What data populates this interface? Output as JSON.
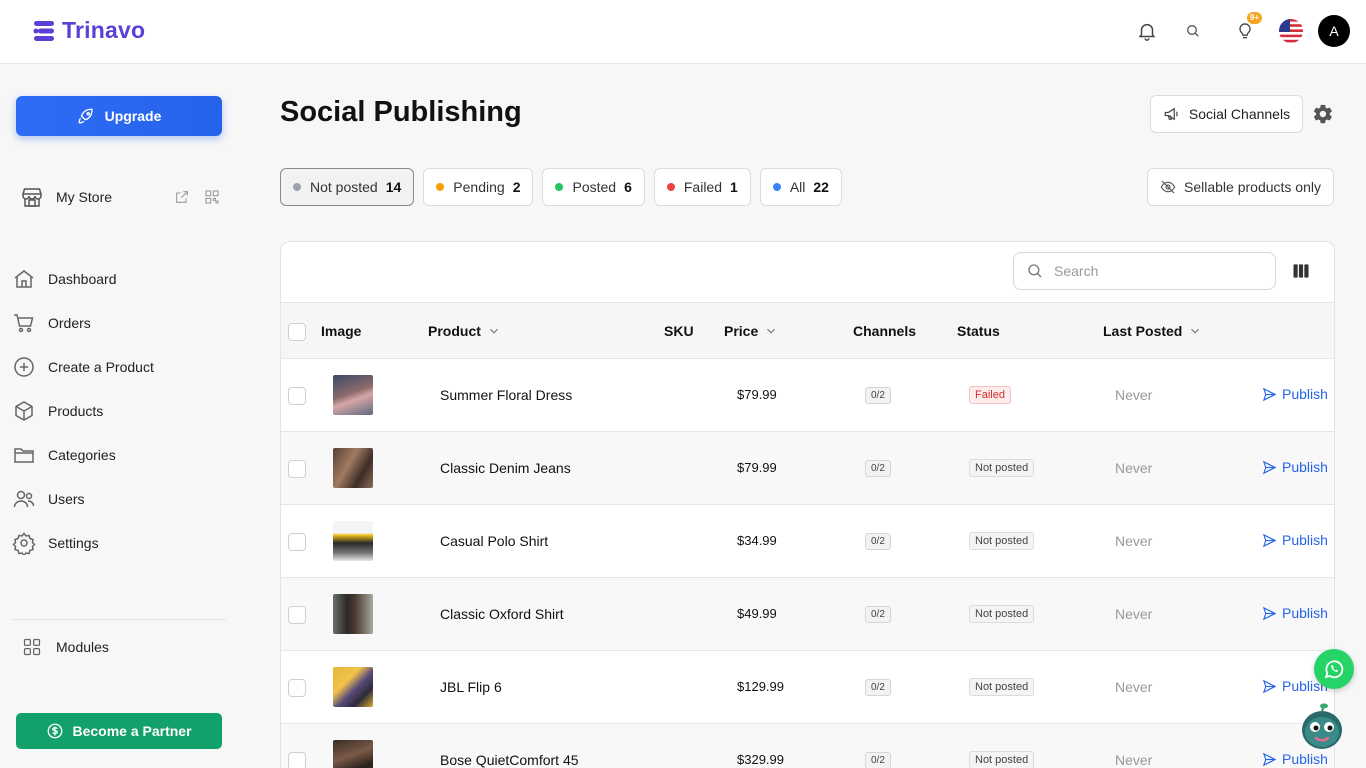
{
  "app": {
    "name": "Trinavo"
  },
  "topbar": {
    "notification_badge": "9+",
    "avatar_initial": "A",
    "icons": [
      "bell-icon",
      "search-icon",
      "lightbulb-icon",
      "us-flag-icon"
    ]
  },
  "sidebar": {
    "upgrade_label": "Upgrade",
    "store_label": "My Store",
    "nav": [
      {
        "label": "Dashboard",
        "icon": "home-icon"
      },
      {
        "label": "Orders",
        "icon": "cart-icon"
      },
      {
        "label": "Create a Product",
        "icon": "plus-circle-icon"
      },
      {
        "label": "Products",
        "icon": "box-icon"
      },
      {
        "label": "Categories",
        "icon": "folder-icon"
      },
      {
        "label": "Users",
        "icon": "users-icon"
      },
      {
        "label": "Settings",
        "icon": "gear-icon"
      }
    ],
    "modules_label": "Modules",
    "partner_label": "Become a Partner"
  },
  "page": {
    "title": "Social Publishing",
    "social_channels_label": "Social Channels",
    "sellable_label": "Sellable products only",
    "filters": [
      {
        "label": "Not posted",
        "count": "14",
        "color": "#9ca3af"
      },
      {
        "label": "Pending",
        "count": "2",
        "color": "#f59e0b"
      },
      {
        "label": "Posted",
        "count": "6",
        "color": "#22c55e"
      },
      {
        "label": "Failed",
        "count": "1",
        "color": "#ef4444"
      },
      {
        "label": "All",
        "count": "22",
        "color": "#3b82f6"
      }
    ],
    "search_placeholder": "Search"
  },
  "table": {
    "columns": [
      "Image",
      "Product",
      "SKU",
      "Price",
      "Channels",
      "Status",
      "Last Posted"
    ],
    "rows": [
      {
        "product": "Summer Floral Dress",
        "sku": "",
        "price": "$79.99",
        "channels": "0/2",
        "status": "Failed",
        "last_posted": "Never",
        "action": "Publish"
      },
      {
        "product": "Classic Denim Jeans",
        "sku": "",
        "price": "$79.99",
        "channels": "0/2",
        "status": "Not posted",
        "last_posted": "Never",
        "action": "Publish"
      },
      {
        "product": "Casual Polo Shirt",
        "sku": "",
        "price": "$34.99",
        "channels": "0/2",
        "status": "Not posted",
        "last_posted": "Never",
        "action": "Publish"
      },
      {
        "product": "Classic Oxford Shirt",
        "sku": "",
        "price": "$49.99",
        "channels": "0/2",
        "status": "Not posted",
        "last_posted": "Never",
        "action": "Publish"
      },
      {
        "product": "JBL Flip 6",
        "sku": "",
        "price": "$129.99",
        "channels": "0/2",
        "status": "Not posted",
        "last_posted": "Never",
        "action": "Publish"
      },
      {
        "product": "Bose QuietComfort 45",
        "sku": "",
        "price": "$329.99",
        "channels": "0/2",
        "status": "Not posted",
        "last_posted": "Never",
        "action": "Publish"
      }
    ]
  }
}
